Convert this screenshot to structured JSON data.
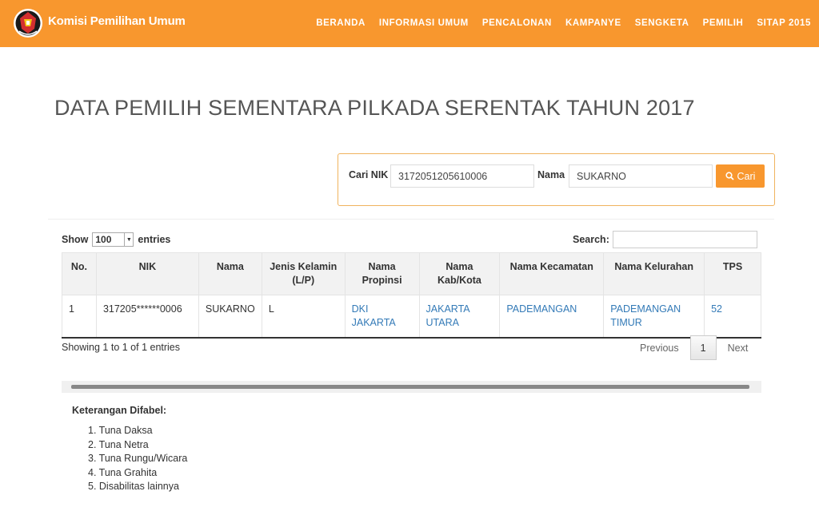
{
  "header": {
    "brand": "Komisi Pemilihan Umum",
    "logo_text": "KOMISI PEMILIHAN UMUM",
    "nav": [
      "BERANDA",
      "INFORMASI UMUM",
      "PENCALONAN",
      "KAMPANYE",
      "SENGKETA",
      "PEMILIH",
      "SITAP 2015"
    ]
  },
  "page_title": "DATA PEMILIH SEMENTARA PILKADA SERENTAK TAHUN 2017",
  "search": {
    "nik_label": "Cari NIK",
    "nik_value": "3172051205610006",
    "nama_label": "Nama",
    "nama_value": "SUKARNO",
    "button_label": "Cari"
  },
  "table_controls": {
    "show_label": "Show",
    "entries_value": "100",
    "entries_label": "entries",
    "search_label": "Search:"
  },
  "table": {
    "columns": [
      [
        "No."
      ],
      [
        "NIK"
      ],
      [
        "Nama"
      ],
      [
        "Jenis Kelamin",
        "(L/P)"
      ],
      [
        "Nama",
        "Propinsi"
      ],
      [
        "Nama",
        "Kab/Kota"
      ],
      [
        "Nama Kecamatan"
      ],
      [
        "Nama Kelurahan"
      ],
      [
        "TPS"
      ]
    ],
    "rows": [
      {
        "no": "1",
        "nik": "317205******0006",
        "nama": "SUKARNO",
        "jk": "L",
        "propinsi": "DKI JAKARTA",
        "kabkota": [
          "JAKARTA",
          "UTARA"
        ],
        "kecamatan": "PADEMANGAN",
        "kelurahan": [
          "PADEMANGAN",
          "TIMUR"
        ],
        "tps": "52"
      }
    ]
  },
  "footer": {
    "info": "Showing 1 to 1 of 1 entries",
    "prev": "Previous",
    "page": "1",
    "next": "Next"
  },
  "keterangan": {
    "title": "Keterangan Difabel:",
    "items": [
      "1. Tuna Daksa",
      "2. Tuna Netra",
      "3. Tuna Rungu/Wicara",
      "4. Tuna Grahita",
      "5. Disabilitas lainnya"
    ]
  },
  "colors": {
    "accent": "#f8972e",
    "link": "#337ab7"
  },
  "icons": {
    "search_button": "search-icon",
    "logo": "kpu-logo"
  }
}
